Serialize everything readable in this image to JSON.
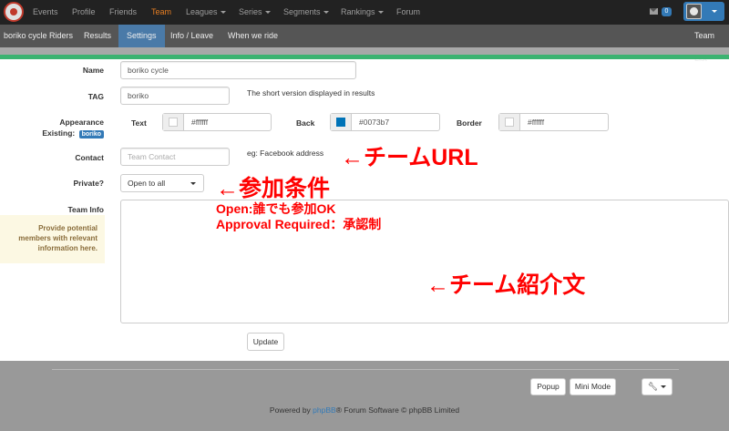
{
  "nav": {
    "items": [
      {
        "label": "Events",
        "dropdown": false,
        "active": false
      },
      {
        "label": "Profile",
        "dropdown": false,
        "active": false
      },
      {
        "label": "Friends",
        "dropdown": false,
        "active": false
      },
      {
        "label": "Team",
        "dropdown": false,
        "active": true
      },
      {
        "label": "Leagues",
        "dropdown": true,
        "active": false
      },
      {
        "label": "Series",
        "dropdown": true,
        "active": false
      },
      {
        "label": "Segments",
        "dropdown": true,
        "active": false
      },
      {
        "label": "Rankings",
        "dropdown": true,
        "active": false
      },
      {
        "label": "Forum",
        "dropdown": false,
        "active": false
      }
    ],
    "mail_count": "0",
    "logo_icon": "zwiftpower-logo",
    "user_icon": "user-avatar-icon"
  },
  "subnav": {
    "items": [
      {
        "label": "boriko cycle Riders"
      },
      {
        "label": "Results"
      },
      {
        "label": "Settings",
        "active": true
      },
      {
        "label": "Info / Leave"
      },
      {
        "label": "When we ride"
      }
    ],
    "right": "Team List"
  },
  "form": {
    "name_label": "Name",
    "name_value": "boriko cycle",
    "tag_label": "TAG",
    "tag_value": "boriko",
    "tag_help": "The short version displayed in results",
    "appearance_label": "Appearance",
    "existing_label": "Existing:",
    "existing_badge": "boriko",
    "text_label": "Text",
    "text_color": "#ffffff",
    "back_label": "Back",
    "back_color": "#0073b7",
    "border_label": "Border",
    "border_color": "#ffffff",
    "contact_label": "Contact",
    "contact_placeholder": "Team Contact",
    "contact_help": "eg: Facebook address",
    "private_label": "Private?",
    "private_value": "Open to all",
    "teaminfo_label": "Team Info",
    "notice": [
      "Provide potential",
      "members with relevant",
      "information here."
    ],
    "update_button": "Update"
  },
  "annotations": {
    "url": "←チームURL",
    "condition": "←参加条件",
    "open_note": "Open:誰でも参加OK",
    "approval_note": "Approval Required：承認制",
    "intro": "←チーム紹介文",
    "color": "#ff0000"
  },
  "footer": {
    "popup_button": "Popup",
    "minimode_button": "Mini Mode",
    "powered_prefix": "Powered by ",
    "powered_link": "phpBB",
    "powered_suffix": "® Forum Software © phpBB Limited"
  }
}
